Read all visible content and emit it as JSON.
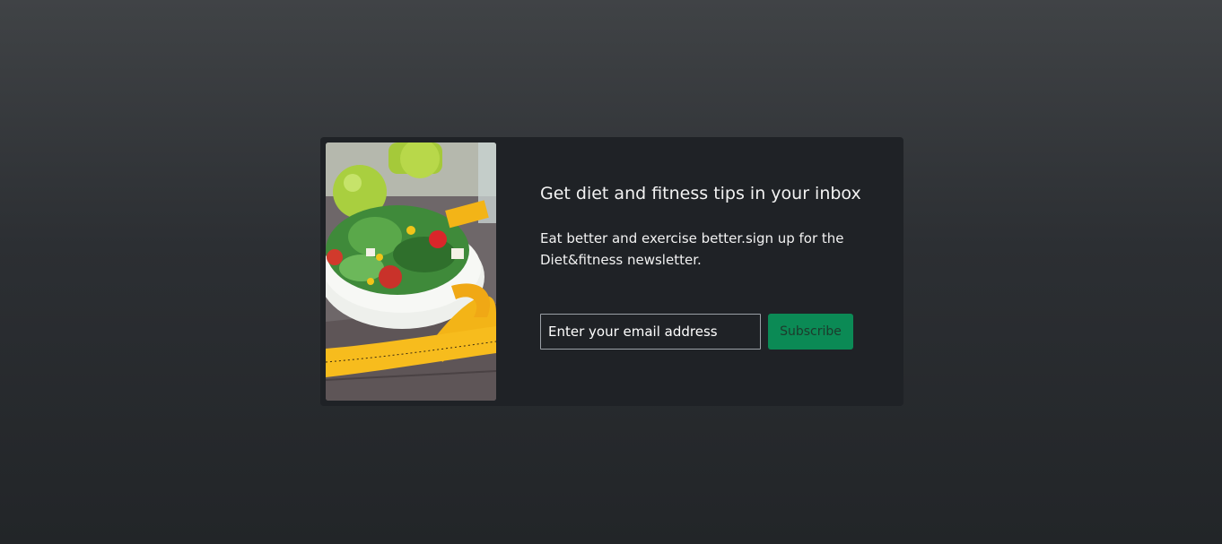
{
  "newsletter": {
    "title": "Get diet and fitness tips in your inbox",
    "description": "Eat better and exercise better.sign up for the Diet&fitness newsletter.",
    "email_placeholder": "Enter your email address",
    "subscribe_label": "Subscribe",
    "image_alt": "salad bowl with measuring tape"
  },
  "colors": {
    "card_background": "#1f2226",
    "button_green": "#0b8a55",
    "text": "#f2f2f2"
  }
}
